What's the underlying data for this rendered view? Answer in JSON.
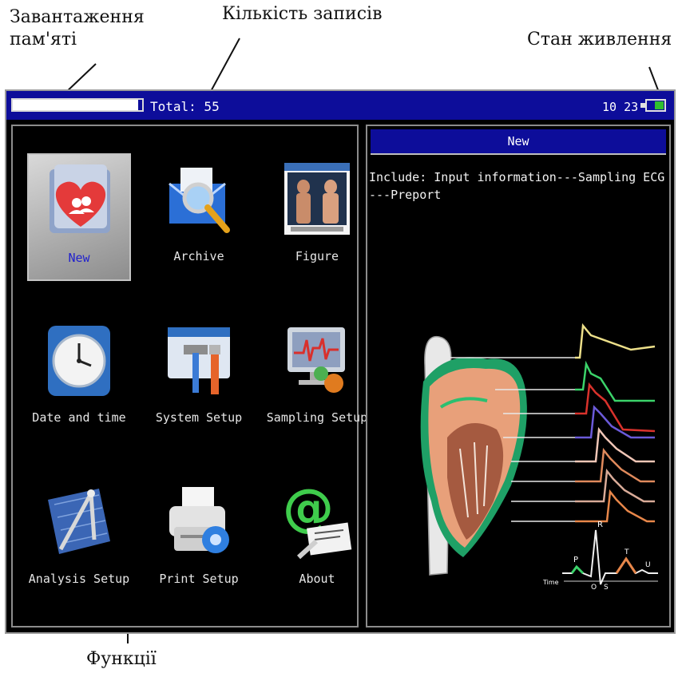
{
  "annotations": {
    "memory": "Завантаження\nпам'яті",
    "records": "Кількість записів",
    "power": "Стан живлення",
    "functions": "Функції"
  },
  "status_bar": {
    "memory_usage_fraction": 0.97,
    "total_label": "Total: 55",
    "time": "10 23",
    "battery_level_fraction": 0.6,
    "bar_color": "#0d0d9a",
    "battery_color": "#2fbf2f"
  },
  "menu": {
    "items": [
      {
        "label": "New",
        "icon": "folder-heart-icon",
        "selected": true
      },
      {
        "label": "Archive",
        "icon": "magnifier-envelope-icon",
        "selected": false
      },
      {
        "label": "Figure",
        "icon": "anatomy-figure-icon",
        "selected": false
      },
      {
        "label": "Date and time",
        "icon": "clock-icon",
        "selected": false
      },
      {
        "label": "System Setup",
        "icon": "tools-icon",
        "selected": false
      },
      {
        "label": "Sampling Setup",
        "icon": "monitor-gear-icon",
        "selected": false
      },
      {
        "label": "Analysis Setup",
        "icon": "drafting-compass-icon",
        "selected": false
      },
      {
        "label": "Print Setup",
        "icon": "printer-gear-icon",
        "selected": false
      },
      {
        "label": "About",
        "icon": "at-sign-card-icon",
        "selected": false
      }
    ]
  },
  "detail": {
    "title": "New",
    "description": "Include: Input information---Sampling ECG---Preport",
    "image": "heart-ecg-illustration",
    "ecg_labels": {
      "p": "P",
      "q": "Q",
      "r": "R",
      "s": "S",
      "t": "T",
      "u": "U",
      "time": "Time"
    }
  }
}
